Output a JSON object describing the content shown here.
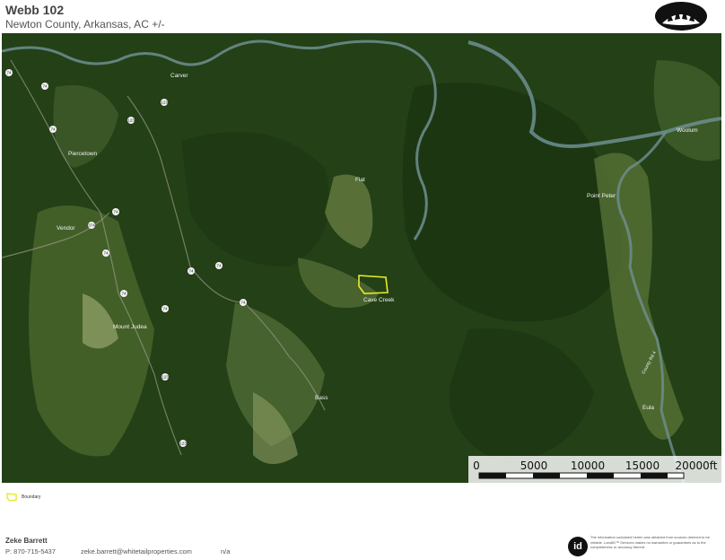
{
  "header": {
    "title": "Webb 102",
    "subtitle": "Newton County, Arkansas,  AC +/-"
  },
  "map": {
    "places": [
      {
        "name": "Carver"
      },
      {
        "name": "Piercetown"
      },
      {
        "name": "Vendor"
      },
      {
        "name": "Mount Judea"
      },
      {
        "name": "Flat"
      },
      {
        "name": "Cave Creek"
      },
      {
        "name": "Bass"
      },
      {
        "name": "Point Peter"
      },
      {
        "name": "Woolum"
      },
      {
        "name": "Eula"
      },
      {
        "name": "County Rd 4"
      }
    ],
    "road_labels": [
      "74",
      "123",
      "123",
      "74",
      "374",
      "74",
      "74",
      "74",
      "74",
      "74",
      "74",
      "74",
      "74",
      "123",
      "123"
    ],
    "colors": {
      "forest": "#234017",
      "river": "#6f8f91",
      "field": "#7f9057",
      "boundary": "#e8ec2a"
    }
  },
  "scale_bar": {
    "labels": [
      "0",
      "5000",
      "10000",
      "15000",
      "20000ft"
    ]
  },
  "legend": {
    "label": "Boundary",
    "color": "#e8ec2a"
  },
  "footer": {
    "agent_name": "Zeke Barrett",
    "phone": "P: 870-715-5437",
    "email": "zeke.barrett@whitetailproperties.com",
    "na": "n/a",
    "badge": "id",
    "disclaimer": "The information contained herein was obtained from sources deemed to be reliable. LandID™ Services makes no warranties or guarantees as to the completeness or accuracy thereof."
  }
}
